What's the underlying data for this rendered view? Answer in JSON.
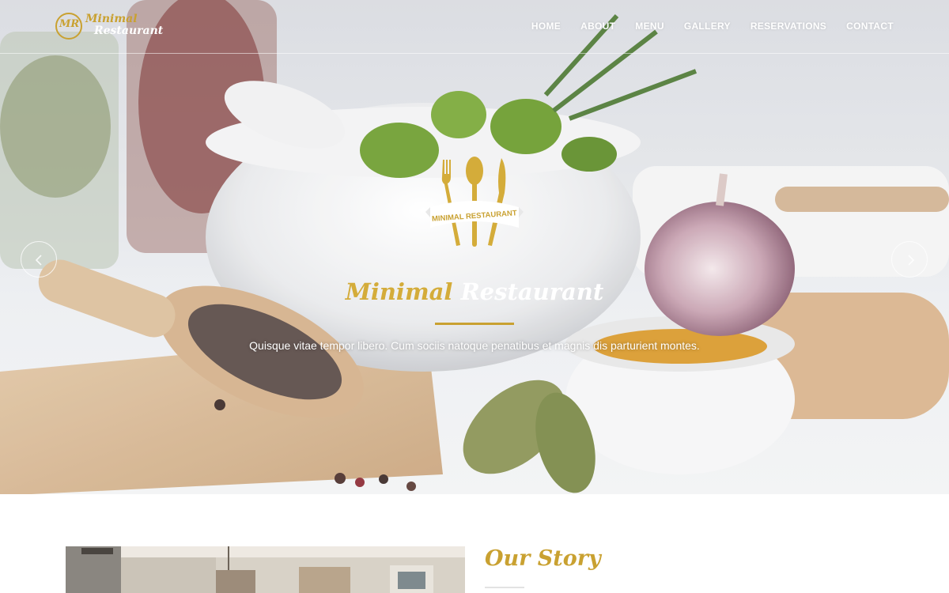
{
  "brand": {
    "initials": "MR",
    "word1": "Minimal",
    "word2": "Restaurant"
  },
  "nav": {
    "items": [
      "HOME",
      "ABOUT",
      "MENU",
      "GALLERY",
      "RESERVATIONS",
      "CONTACT"
    ]
  },
  "hero": {
    "emblem_text": "MINIMAL RESTAURANT",
    "title_part1": "Minimal",
    "title_part2": "Restaurant",
    "tagline": "Quisque vitae tempor libero. Cum sociis natoque penatibus et magnis dis parturient montes.",
    "prev_icon": "chevron-left-icon",
    "next_icon": "chevron-right-icon"
  },
  "story": {
    "title": "Our Story"
  },
  "colors": {
    "gold": "#c9a131",
    "white": "#ffffff"
  }
}
